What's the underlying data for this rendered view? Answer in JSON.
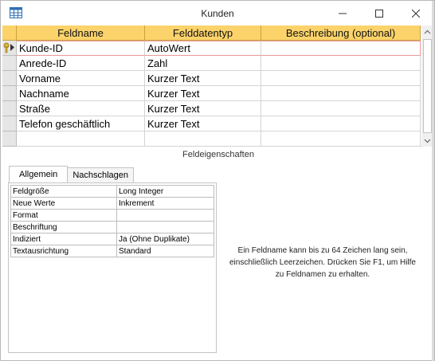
{
  "window": {
    "title": "Kunden",
    "icon": "table-icon",
    "controls": [
      "minimize-icon",
      "maximize-icon",
      "close-icon"
    ]
  },
  "grid": {
    "columns": [
      "Feldname",
      "Felddatentyp",
      "Beschreibung (optional)"
    ],
    "rows": [
      {
        "field": "Kunde-ID",
        "type": "AutoWert",
        "description": "",
        "primary_key": true,
        "selected": true
      },
      {
        "field": "Anrede-ID",
        "type": "Zahl",
        "description": ""
      },
      {
        "field": "Vorname",
        "type": "Kurzer Text",
        "description": ""
      },
      {
        "field": "Nachname",
        "type": "Kurzer Text",
        "description": ""
      },
      {
        "field": "Straße",
        "type": "Kurzer Text",
        "description": ""
      },
      {
        "field": "Telefon geschäftlich",
        "type": "Kurzer Text",
        "description": ""
      },
      {
        "field": "",
        "type": "",
        "description": ""
      }
    ],
    "header_color": "#fbd36a",
    "selection_color": "#e89a9a"
  },
  "properties": {
    "title": "Feldeigenschaften",
    "tabs": [
      "Allgemein",
      "Nachschlagen"
    ],
    "active_tab": "Allgemein",
    "items": [
      {
        "key": "Feldgröße",
        "value": "Long Integer"
      },
      {
        "key": "Neue Werte",
        "value": "Inkrement"
      },
      {
        "key": "Format",
        "value": ""
      },
      {
        "key": "Beschriftung",
        "value": ""
      },
      {
        "key": "Indiziert",
        "value": "Ja (Ohne Duplikate)"
      },
      {
        "key": "Textausrichtung",
        "value": "Standard"
      }
    ],
    "hint": "Ein Feldname kann bis zu 64 Zeichen lang sein, einschließlich Leerzeichen. Drücken Sie F1, um Hilfe zu Feldnamen zu erhalten."
  }
}
